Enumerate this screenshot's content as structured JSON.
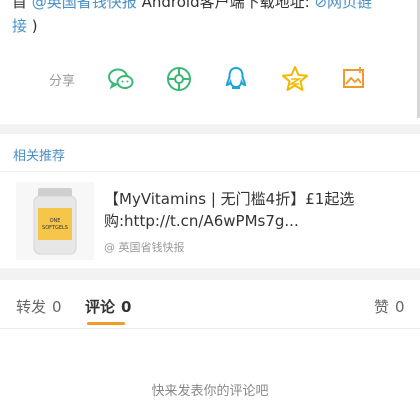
{
  "post_text": {
    "line1_prefix": "首",
    "line1_mention": "@英国省钱快报",
    "line1_middle": "Android客户端下载地址:",
    "line1_link_icon": "link-icon",
    "line1_link": "网页链",
    "line2_link": "接",
    "line2_suffix": ")"
  },
  "share": {
    "label": "分享",
    "icons": [
      "wechat-icon",
      "moments-icon",
      "qq-icon",
      "qzone-icon",
      "screenshot-icon"
    ],
    "colors": {
      "wechat": "#3bb873",
      "moments": "#3bb873",
      "qq": "#1aa3d9",
      "qzone": "#f1b800",
      "screenshot": "#f19a2a"
    }
  },
  "related": {
    "title": "相关推荐",
    "card": {
      "title": "【MyVitamins | 无门槛4折】£1起选购:http://t.cn/A6wPMs7g...",
      "source": "@ 英国省钱快报",
      "thumb_label": "ONE SOFTGELS"
    }
  },
  "tabs": [
    {
      "label": "转发",
      "count": "0"
    },
    {
      "label": "评论",
      "count": "0",
      "active": true
    },
    {
      "label": "赞",
      "count": "0"
    }
  ],
  "comments": {
    "empty_text": "快来发表你的评论吧"
  },
  "colors": {
    "link": "#4a90c8",
    "accent": "#f19a2a"
  }
}
